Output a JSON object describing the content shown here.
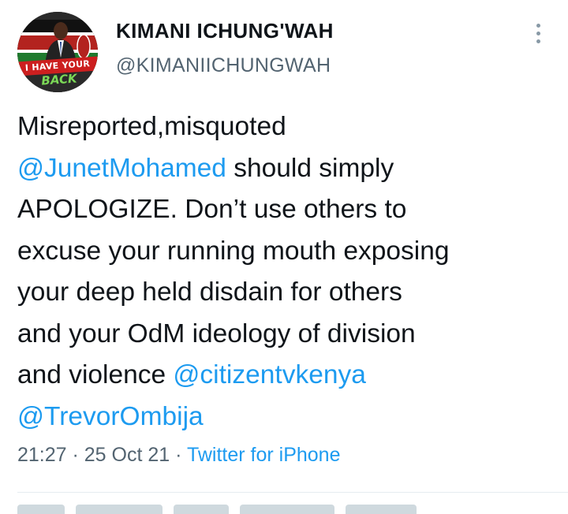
{
  "author": {
    "display_name": "KIMANI ICHUNG'WAH",
    "handle": "@KIMANIICHUNGWAH",
    "avatar_banner_text": "I HAVE YOUR",
    "avatar_back_text": "BACK"
  },
  "tweet": {
    "lines": [
      [
        {
          "text": "Misreported,misquoted",
          "mention": false
        }
      ],
      [
        {
          "text": "@JunetMohamed",
          "mention": true
        },
        {
          "text": " should simply",
          "mention": false
        }
      ],
      [
        {
          "text": "APOLOGIZE. Don’t use others to",
          "mention": false
        }
      ],
      [
        {
          "text": "excuse your running mouth exposing",
          "mention": false
        }
      ],
      [
        {
          "text": "your deep held disdain for others",
          "mention": false
        }
      ],
      [
        {
          "text": "and your OdM ideology of division",
          "mention": false
        }
      ],
      [
        {
          "text": "and violence ",
          "mention": false
        },
        {
          "text": "@citizentvkenya",
          "mention": true
        }
      ],
      [
        {
          "text": "@TrevorOmbija",
          "mention": true
        }
      ]
    ]
  },
  "meta": {
    "time": "21:27",
    "separator1": " · ",
    "date": "25 Oct 21",
    "separator2": " · ",
    "source": "Twitter for iPhone"
  },
  "colors": {
    "link": "#1d9bf0",
    "secondary_text": "#536471",
    "primary_text": "#0f1419"
  },
  "icons": {
    "more": "more-vertical-icon"
  }
}
